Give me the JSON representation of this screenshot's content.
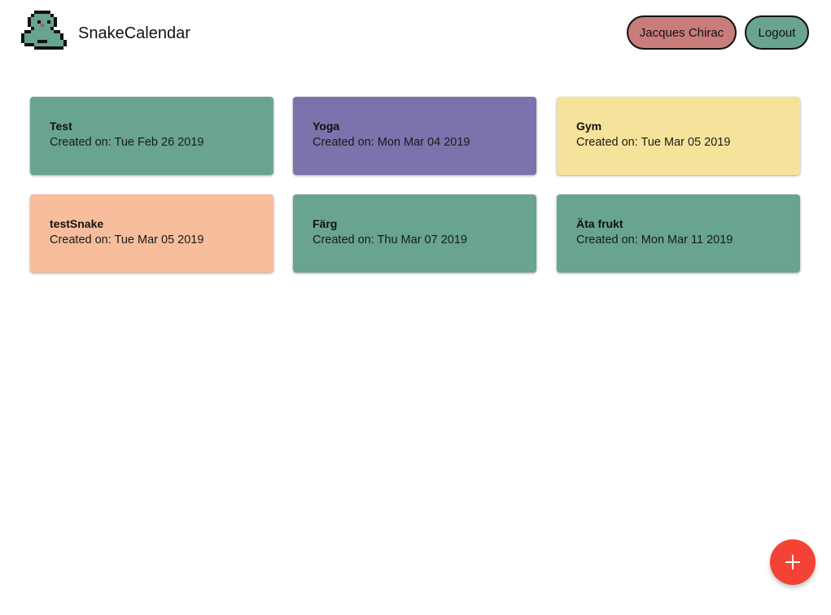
{
  "header": {
    "app_title": "SnakeCalendar",
    "user_label": "Jacques Chirac",
    "logout_label": "Logout"
  },
  "colors": {
    "green": "#68a491",
    "purple": "#7d72ab",
    "yellow": "#f6e39b",
    "peach": "#f7bd9d",
    "user_button": "#c97c7a",
    "fab": "#f44336"
  },
  "calendars": [
    {
      "title": "Test",
      "created": "Created on: Tue Feb 26 2019",
      "color": "#68a491"
    },
    {
      "title": "Yoga",
      "created": "Created on: Mon Mar 04 2019",
      "color": "#7d72ab"
    },
    {
      "title": "Gym",
      "created": "Created on: Tue Mar 05 2019",
      "color": "#f6e39b"
    },
    {
      "title": "testSnake",
      "created": "Created on: Tue Mar 05 2019",
      "color": "#f7bd9d"
    },
    {
      "title": "Färg",
      "created": "Created on: Thu Mar 07 2019",
      "color": "#68a491"
    },
    {
      "title": "Äta frukt",
      "created": "Created on: Mon Mar 11 2019",
      "color": "#68a491"
    }
  ],
  "fab": {
    "icon": "plus-icon"
  }
}
